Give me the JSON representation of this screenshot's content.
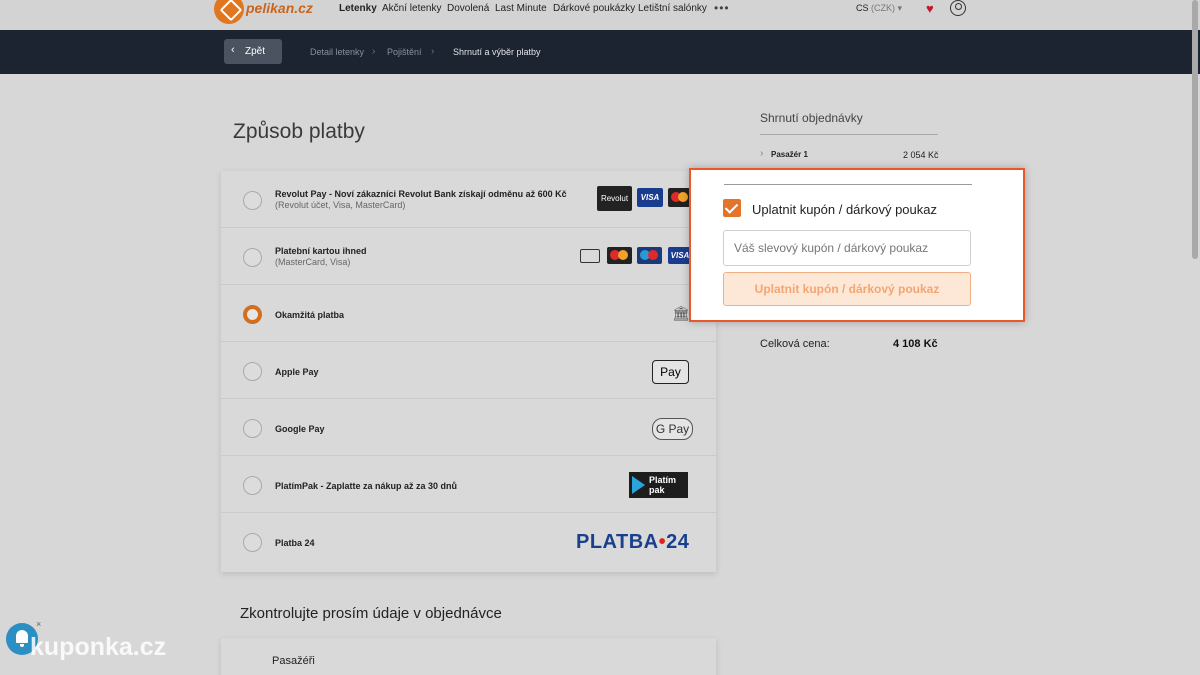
{
  "nav": {
    "logo_text": "pelikan.cz",
    "items": [
      "Letenky",
      "Akční letenky",
      "Dovolená",
      "Last Minute",
      "Dárkové poukázky",
      "Letištní salónky"
    ],
    "more": "•••",
    "currency_code": "CS",
    "currency_detail": "(CZK)"
  },
  "breadcrumb": {
    "back_label": "Zpět",
    "steps": [
      "Detail letenky",
      "Pojištění",
      "Shrnutí a výběr platby"
    ]
  },
  "payment": {
    "title": "Způsob platby",
    "methods": [
      {
        "title": "Revolut Pay - Noví zákazníci Revolut Bank získají odměnu až 600 Kč",
        "subtitle": "(Revolut účet, Visa, MasterCard)",
        "selected": false
      },
      {
        "title": "Platební kartou ihned",
        "subtitle": "(MasterCard, Visa)",
        "selected": false
      },
      {
        "title": "Okamžitá platba",
        "subtitle": "",
        "selected": true
      },
      {
        "title": "Apple Pay",
        "subtitle": "",
        "selected": false
      },
      {
        "title": "Google Pay",
        "subtitle": "",
        "selected": false
      },
      {
        "title": "PlatímPak - Zaplatte za nákup až za 30 dnů",
        "subtitle": "",
        "selected": false
      },
      {
        "title": "Platba 24",
        "subtitle": "",
        "selected": false
      }
    ],
    "logos": {
      "revolut": "Revolut",
      "visa": "VISA",
      "applepay": " Pay",
      "gpay": "G Pay",
      "platimpak_line1": "Platím",
      "platimpak_line2": "pak",
      "platba24_a": "PLATBA",
      "platba24_dot": "•",
      "platba24_b": "24"
    }
  },
  "review": {
    "title": "Zkontrolujte prosím údaje v objednávce",
    "passengers_label": "Pasažéři"
  },
  "summary": {
    "title": "Shrnutí objednávky",
    "passenger_label": "Pasažér 1",
    "passenger_price": "2 054 Kč",
    "total_label": "Celková cena:",
    "total_value": "4 108 Kč"
  },
  "coupon": {
    "checkbox_label": "Uplatnit kupón / dárkový poukaz",
    "checked": true,
    "input_placeholder": "Váš slevový kupón / dárkový poukaz",
    "input_value": "",
    "button_label": "Uplatnit kupón / dárkový poukaz"
  },
  "watermark": {
    "text": "kuponka.cz",
    "close": "×"
  },
  "colors": {
    "accent": "#e2752a",
    "highlight_border": "#e8582b",
    "header_dark": "#1c2331",
    "platba24_blue": "#1a3f8f"
  },
  "icons": [
    "logo-icon",
    "heart-icon",
    "user-icon",
    "chevron-left-icon",
    "chevron-right-icon",
    "bank-icon",
    "card-icon",
    "bell-icon",
    "checkbox-checked-icon"
  ]
}
